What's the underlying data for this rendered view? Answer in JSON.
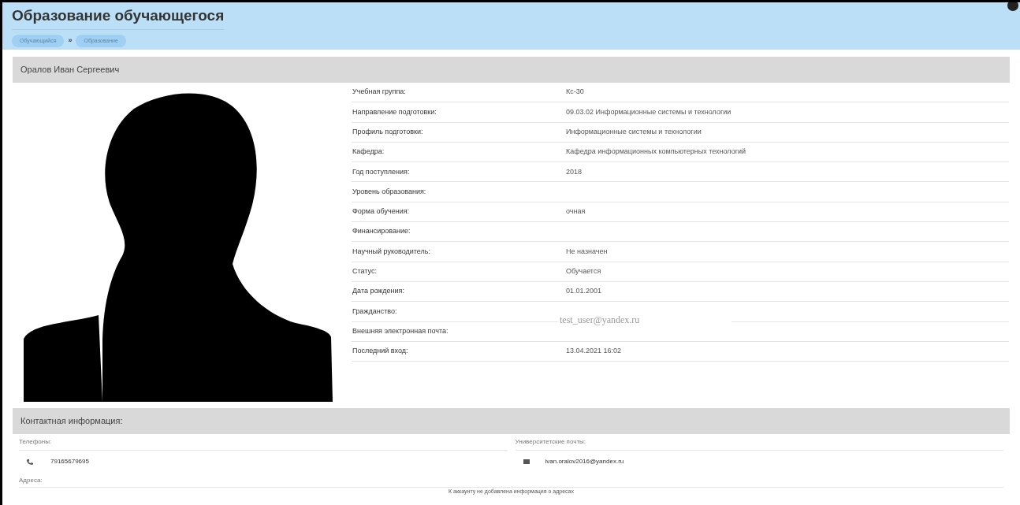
{
  "page": {
    "title": "Образование обучающегося"
  },
  "breadcrumbs": [
    {
      "label": "Обучающийся"
    },
    {
      "separator": "»",
      "label": "Образование"
    }
  ],
  "student": {
    "name": "Оралов Иван Сергеевич",
    "fields": [
      {
        "label": "Учебная группа:",
        "value": "Кс-30"
      },
      {
        "label": "Направление подготовки:",
        "value": "09.03.02 Информационные системы и технологии"
      },
      {
        "label": "Профиль подготовки:",
        "value": "Информационные системы и технологии"
      },
      {
        "label": "Кафедра:",
        "value": "Кафедра информационных компьютерных технологий"
      },
      {
        "label": "Год поступления:",
        "value": "2018"
      },
      {
        "label": "Уровень образования:"
      },
      {
        "label": "Форма обучения:",
        "value": "очная"
      },
      {
        "label": "Финансирование:"
      },
      {
        "label": "Научный руководитель:",
        "value": "Не назначен"
      },
      {
        "label": "Статус:",
        "value": "Обучается"
      },
      {
        "label": "Дата рождения:",
        "value": "01.01.2001"
      },
      {
        "label": "Гражданство:",
        "overlay": "test_user@yandex.ru"
      },
      {
        "label": "Внешняя электронная почта:"
      },
      {
        "label": "Последний вход:",
        "value": "13.04.2021 16:02"
      }
    ]
  },
  "contacts": {
    "title": "Контактная информация:",
    "phones": {
      "label": "Телефоны:",
      "items": [
        "79165679695"
      ]
    },
    "emails": {
      "label": "Университетские почты:",
      "items": [
        "ivan.oralov2016@yandex.ru"
      ]
    },
    "addresses": {
      "label": "Адреса:",
      "empty_message": "К аккаунту не добавлена информация о адресах"
    }
  }
}
